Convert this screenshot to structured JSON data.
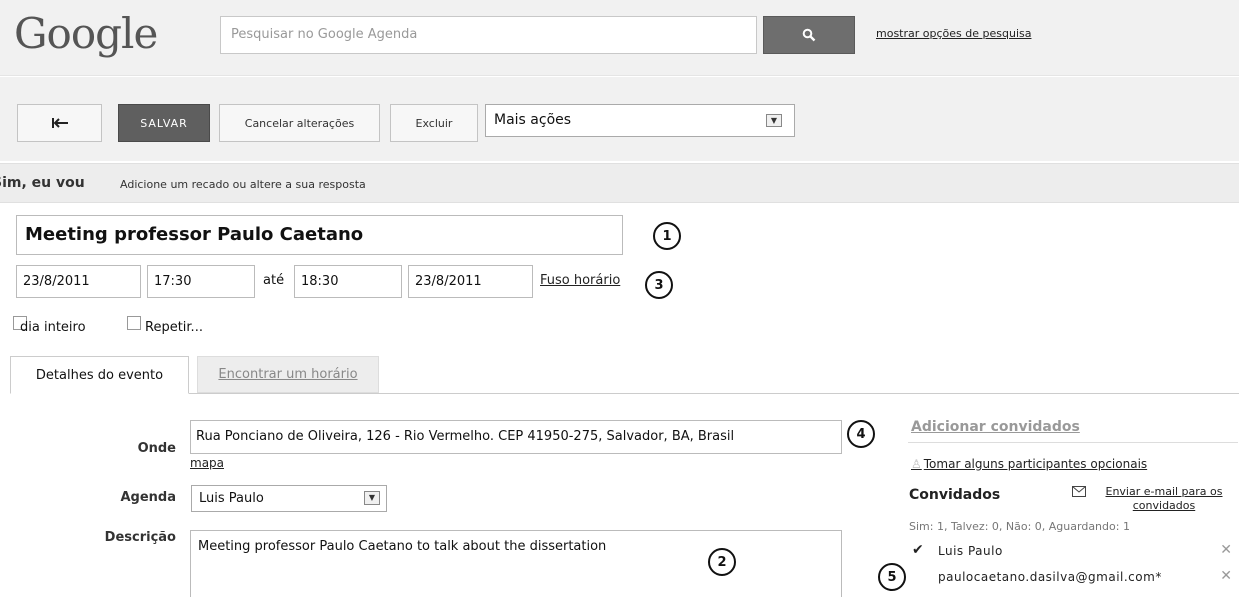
{
  "header": {
    "logo": "Google",
    "search_placeholder": "Pesquisar no Google Agenda",
    "search_options_link": "mostrar opções de pesquisa"
  },
  "toolbar": {
    "save": "SALVAR",
    "cancel": "Cancelar alterações",
    "delete": "Excluir",
    "more_actions": "Mais ações"
  },
  "rsvp": {
    "status": "Sim, eu vou",
    "link": "Adicione um recado ou altere a sua resposta"
  },
  "event": {
    "title": "Meeting professor Paulo Caetano",
    "start_date": "23/8/2011",
    "start_time": "17:30",
    "to_label": "até",
    "end_time": "18:30",
    "end_date": "23/8/2011",
    "timezone_link": "Fuso horário",
    "all_day_label": "dia inteiro",
    "repeat_label": "Repetir..."
  },
  "tabs": {
    "details": "Detalhes do evento",
    "find_time": "Encontrar um horário"
  },
  "details": {
    "where_label": "Onde",
    "where_value": "Rua Ponciano de Oliveira, 126 - Rio Vermelho. CEP 41950-275, Salvador, BA, Brasil",
    "map_link": "mapa",
    "calendar_label": "Agenda",
    "calendar_value": "Luis Paulo",
    "description_label": "Descrição",
    "description_value": "Meeting professor Paulo Caetano to talk about the dissertation"
  },
  "callouts": [
    "1",
    "2",
    "3",
    "4",
    "5"
  ],
  "guests": {
    "add_link": "Adicionar convidados",
    "optional_link": "Tomar alguns participantes opcionais",
    "heading": "Convidados",
    "email_link": "Enviar e-mail para os convidados",
    "counts": "Sim: 1, Talvez: 0, Não: 0, Aguardando: 1",
    "list": [
      {
        "name": "Luis Paulo"
      },
      {
        "name": "paulocaetano.dasilva@gmail.com*"
      }
    ]
  }
}
